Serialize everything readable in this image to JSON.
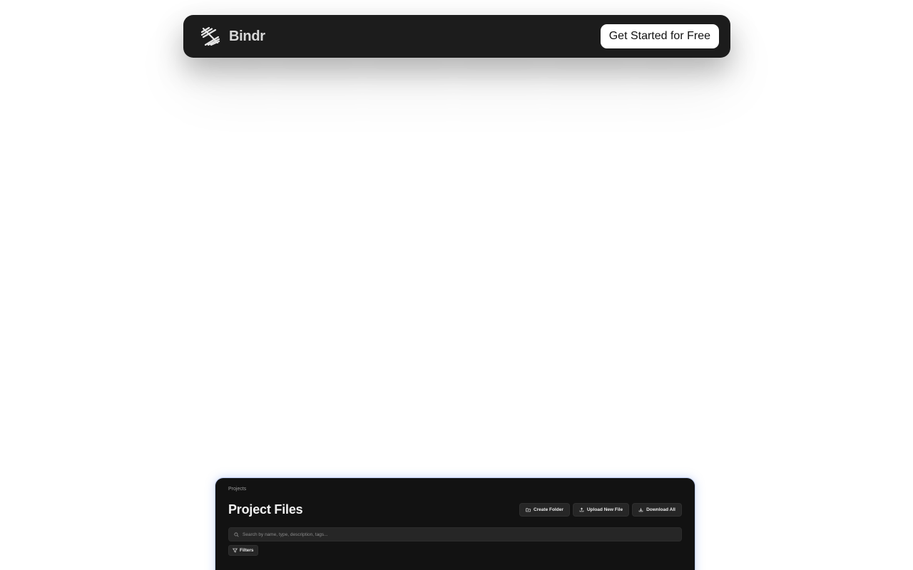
{
  "navbar": {
    "brand_name": "Bindr",
    "brand_icon": "bindr-logo-icon",
    "cta_label": "Get Started for Free"
  },
  "preview": {
    "breadcrumb": "Projects",
    "title": "Project Files",
    "actions": [
      {
        "label": "Create Folder",
        "icon": "folder-plus-icon"
      },
      {
        "label": "Upload New File",
        "icon": "upload-icon"
      },
      {
        "label": "Download All",
        "icon": "download-icon"
      }
    ],
    "search": {
      "placeholder": "Search by name, type, description, tags...",
      "icon": "search-icon"
    },
    "filters_label": "Filters",
    "filters_icon": "filter-icon"
  },
  "colors": {
    "navbar_bg": "#1c1c1c",
    "cta_bg": "#ffffff",
    "panel_bg": "#121212",
    "panel_glow": "#5a82e6"
  }
}
